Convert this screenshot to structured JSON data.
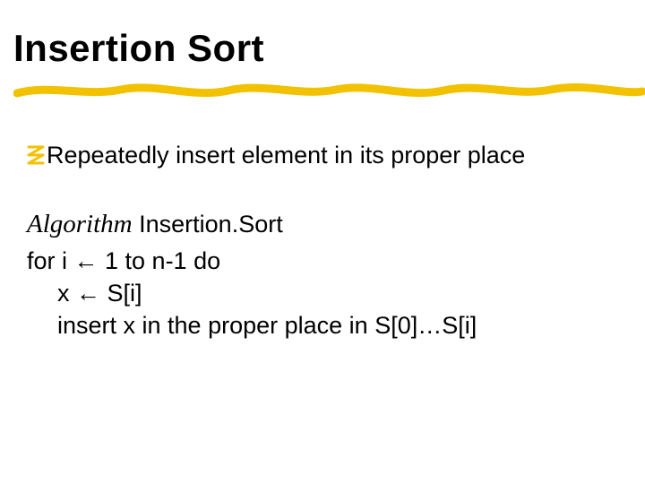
{
  "title": "Insertion Sort",
  "bullet": {
    "text": "Repeatedly insert element in its proper place"
  },
  "algorithm": {
    "keyword": "Algorithm",
    "name": "Insertion.Sort",
    "line1": "for i ← 1 to n-1 do",
    "line2": "x ← S[i]",
    "line3": "insert x in the proper place in S[0]…S[i]"
  }
}
